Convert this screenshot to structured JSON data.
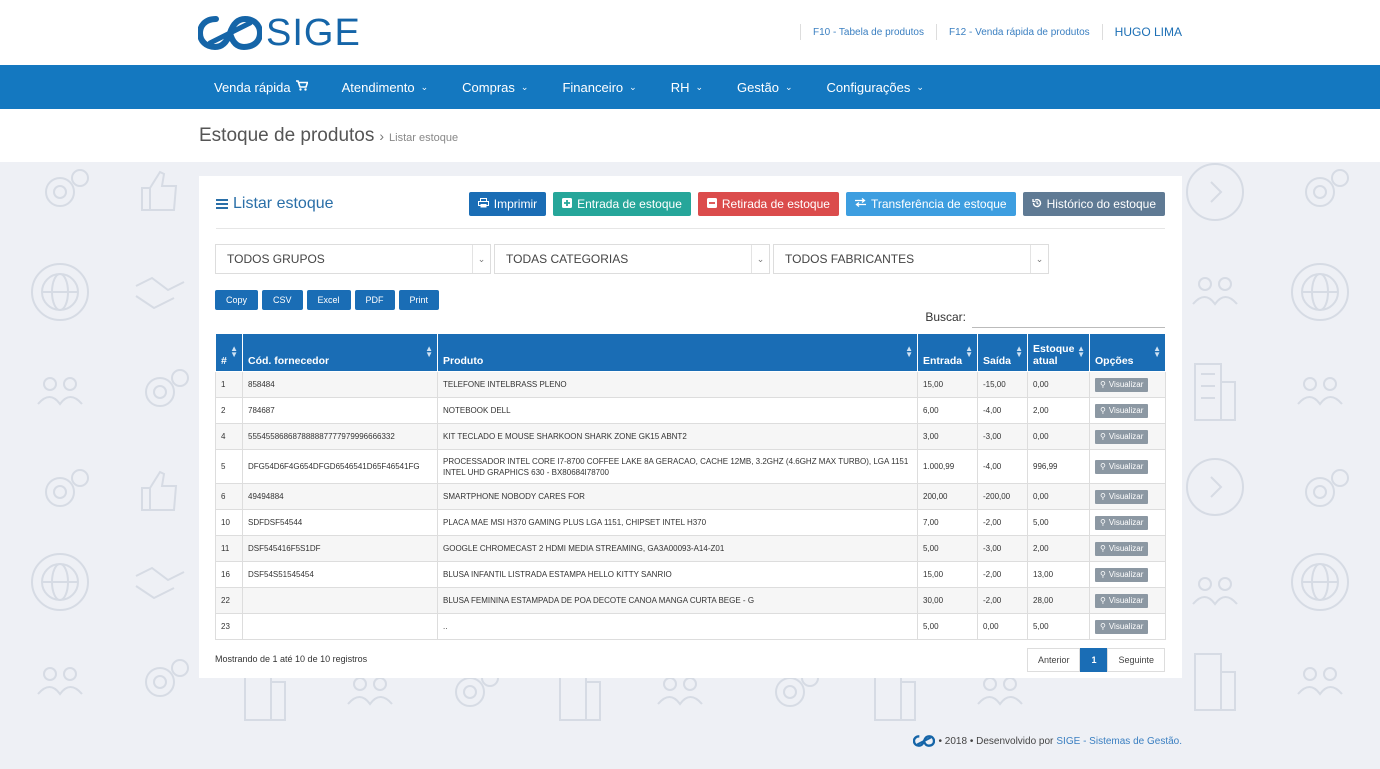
{
  "header": {
    "logo_text": "SIGE",
    "links": [
      "F10 - Tabela de produtos",
      "F12 - Venda rápida de produtos"
    ],
    "user": "HUGO LIMA"
  },
  "nav": {
    "items": [
      {
        "label": "Venda rápida",
        "icon": "cart-icon"
      },
      {
        "label": "Atendimento",
        "icon": "chevron-down-icon"
      },
      {
        "label": "Compras",
        "icon": "chevron-down-icon"
      },
      {
        "label": "Financeiro",
        "icon": "chevron-down-icon"
      },
      {
        "label": "RH",
        "icon": "chevron-down-icon"
      },
      {
        "label": "Gestão",
        "icon": "chevron-down-icon"
      },
      {
        "label": "Configurações",
        "icon": "chevron-down-icon"
      }
    ]
  },
  "breadcrumb": {
    "title": "Estoque de produtos",
    "separator": "›",
    "current": "Listar estoque"
  },
  "panel": {
    "title": "Listar estoque",
    "actions": [
      {
        "label": "Imprimir",
        "icon": "printer-icon",
        "color": "#1a6db5"
      },
      {
        "label": "Entrada de estoque",
        "icon": "plus-square-icon",
        "color": "#26a69a"
      },
      {
        "label": "Retirada de estoque",
        "icon": "minus-square-icon",
        "color": "#db4c4c"
      },
      {
        "label": "Transferência de estoque",
        "icon": "exchange-icon",
        "color": "#3d9ee0"
      },
      {
        "label": "Histórico do estoque",
        "icon": "history-icon",
        "color": "#5f7a94"
      }
    ],
    "filters": [
      "TODOS GRUPOS",
      "TODAS CATEGORIAS",
      "TODOS FABRICANTES"
    ],
    "exports": [
      "Copy",
      "CSV",
      "Excel",
      "PDF",
      "Print"
    ],
    "search_label": "Buscar:",
    "search_value": ""
  },
  "table": {
    "headers": [
      "#",
      "Cód. fornecedor",
      "Produto",
      "Entrada",
      "Saída",
      "Estoque atual",
      "Opções"
    ],
    "view_label": "Visualizar",
    "rows": [
      {
        "id": "1",
        "cod": "858484",
        "produto": "TELEFONE INTELBRASS PLENO",
        "entrada": "15,00",
        "saida": "-15,00",
        "estoque": "0,00"
      },
      {
        "id": "2",
        "cod": "784687",
        "produto": "NOTEBOOK DELL",
        "entrada": "6,00",
        "saida": "-4,00",
        "estoque": "2,00"
      },
      {
        "id": "4",
        "cod": "555455868687888887777979996666332",
        "produto": "KIT TECLADO E MOUSE SHARKOON SHARK ZONE GK15 ABNT2",
        "entrada": "3,00",
        "saida": "-3,00",
        "estoque": "0,00"
      },
      {
        "id": "5",
        "cod": "DFG54D6F4G654DFGD6546541D65F46541FG",
        "produto": "PROCESSADOR INTEL CORE I7-8700 COFFEE LAKE 8A GERACAO, CACHE 12MB, 3.2GHZ (4.6GHZ MAX TURBO), LGA 1151 INTEL UHD GRAPHICS 630 - BX80684I78700",
        "entrada": "1.000,99",
        "saida": "-4,00",
        "estoque": "996,99"
      },
      {
        "id": "6",
        "cod": "49494884",
        "produto": "SMARTPHONE NOBODY CARES FOR",
        "entrada": "200,00",
        "saida": "-200,00",
        "estoque": "0,00"
      },
      {
        "id": "10",
        "cod": "SDFDSF54544",
        "produto": "PLACA MAE MSI H370 GAMING PLUS LGA 1151, CHIPSET INTEL H370",
        "entrada": "7,00",
        "saida": "-2,00",
        "estoque": "5,00"
      },
      {
        "id": "11",
        "cod": "DSF545416F5S1DF",
        "produto": "GOOGLE CHROMECAST 2 HDMI MEDIA STREAMING, GA3A00093-A14-Z01",
        "entrada": "5,00",
        "saida": "-3,00",
        "estoque": "2,00"
      },
      {
        "id": "16",
        "cod": "DSF54S51545454",
        "produto": "BLUSA INFANTIL LISTRADA ESTAMPA HELLO KITTY SANRIO",
        "entrada": "15,00",
        "saida": "-2,00",
        "estoque": "13,00"
      },
      {
        "id": "22",
        "cod": "",
        "produto": "BLUSA FEMININA ESTAMPADA DE POA DECOTE CANOA MANGA CURTA BEGE - G",
        "entrada": "30,00",
        "saida": "-2,00",
        "estoque": "28,00"
      },
      {
        "id": "23",
        "cod": "",
        "produto": "..",
        "entrada": "5,00",
        "saida": "0,00",
        "estoque": "5,00"
      }
    ]
  },
  "pagination": {
    "info": "Mostrando de 1 até 10 de 10 registros",
    "prev": "Anterior",
    "current": "1",
    "next": "Seguinte"
  },
  "footer": {
    "text": "• 2018 • Desenvolvido por",
    "link": "SIGE - Sistemas de Gestão."
  },
  "colors": {
    "primary": "#1478c0",
    "table_header": "#1a6db5"
  }
}
